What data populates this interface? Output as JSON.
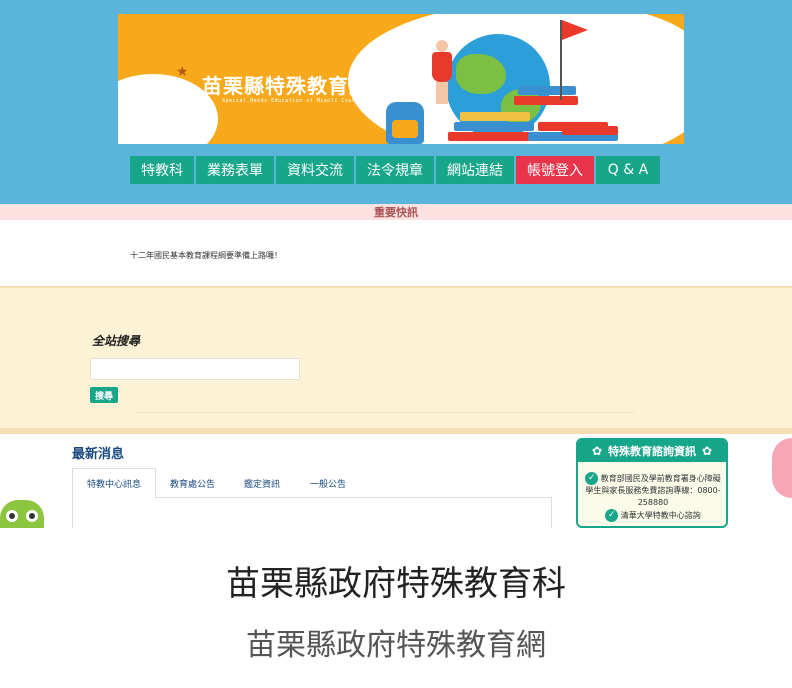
{
  "banner": {
    "title": "苗栗縣特殊教育網",
    "subtitle": "Special Needs Education of Miaoli County"
  },
  "nav": {
    "items": [
      {
        "label": "特教科",
        "color": "#18a68b"
      },
      {
        "label": "業務表單",
        "color": "#18a68b"
      },
      {
        "label": "資料交流",
        "color": "#18a68b"
      },
      {
        "label": "法令規章",
        "color": "#18a68b"
      },
      {
        "label": "網站連結",
        "color": "#18a68b"
      },
      {
        "label": "帳號登入",
        "color": "#e8354b"
      },
      {
        "label": "Q & A",
        "color": "#18a68b"
      }
    ]
  },
  "news": {
    "header": "重要快訊",
    "text": "十二年國民基本教育課程綱要準備上路囉！"
  },
  "search": {
    "title": "全站搜尋",
    "input_value": "",
    "button": "搜尋"
  },
  "latest": {
    "title": "最新消息",
    "tabs": [
      "特教中心訊息",
      "教育處公告",
      "鑑定資訊",
      "一般公告"
    ],
    "active_tab": 0
  },
  "consult": {
    "title": "特殊教育諮詢資訊",
    "line1": "教育部國民及學前教育署身心障礙學生與家長服務免費諮詢專線：0800-258880",
    "line2": "清華大學特教中心諮詢"
  },
  "caption": {
    "title": "苗栗縣政府特殊教育科",
    "subtitle": "苗栗縣政府特殊教育網"
  },
  "colors": {
    "header_bg": "#5bb4da",
    "banner_bg": "#f7a81b",
    "nav_green": "#18a68b",
    "nav_red": "#e8354b",
    "news_bar": "#fde1e1",
    "search_bg": "#fcf2d6"
  }
}
